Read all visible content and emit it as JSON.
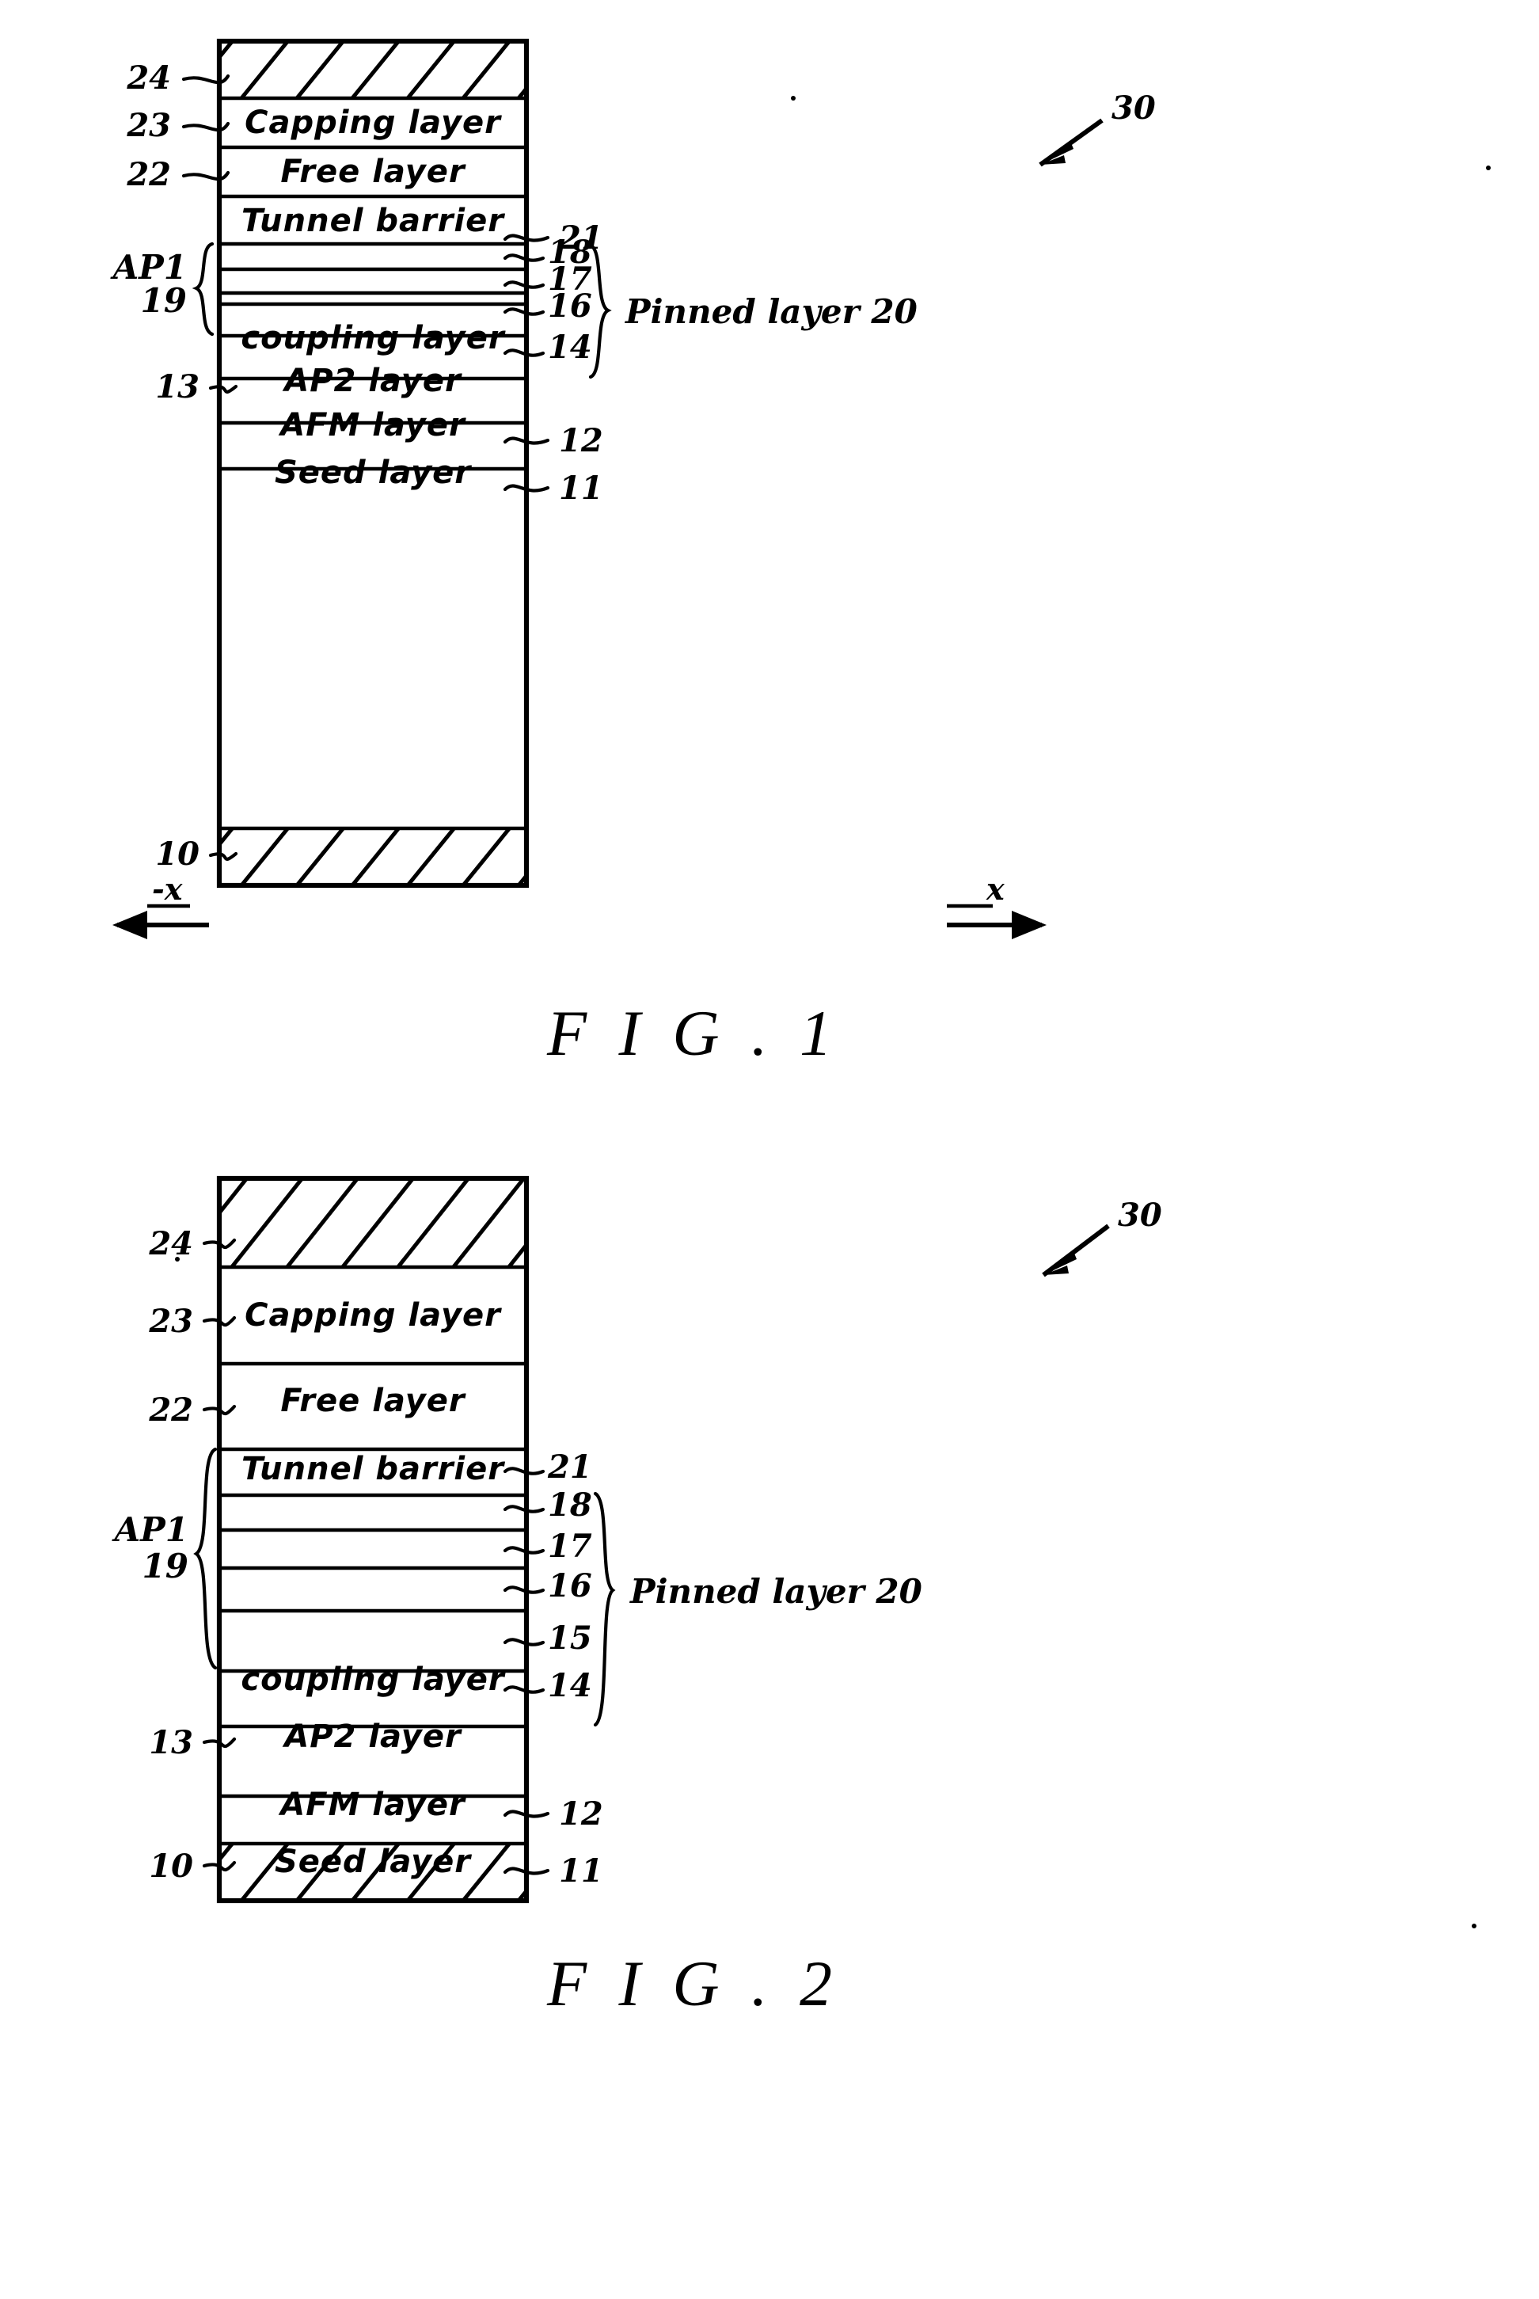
{
  "document": {
    "type": "patent-drawing-sheet",
    "figure_count": 2
  },
  "figures": [
    {
      "id": "fig1",
      "caption": "F I G .   1",
      "assembly_ref": "30",
      "group_left": {
        "label": "AP1",
        "number": "19"
      },
      "group_right": {
        "label": "Pinned layer 20"
      },
      "axis_left": "-x",
      "axis_right": "x",
      "layers": [
        {
          "ref": "24",
          "text": "",
          "side": "left",
          "hatched": true
        },
        {
          "ref": "23",
          "text": "Capping layer",
          "side": "left",
          "hatched": false
        },
        {
          "ref": "22",
          "text": "Free layer",
          "side": "left",
          "hatched": false
        },
        {
          "ref": "21",
          "text": "Tunnel barrier",
          "side": "right",
          "hatched": false
        },
        {
          "ref": "18",
          "text": "",
          "side": "right",
          "hatched": false
        },
        {
          "ref": "17",
          "text": "",
          "side": "right",
          "hatched": false
        },
        {
          "ref": "16",
          "text": "",
          "side": "right",
          "hatched": false
        },
        {
          "ref": "14",
          "text": "coupling layer",
          "side": "right",
          "hatched": false
        },
        {
          "ref": "13",
          "text": "AP2 layer",
          "side": "left",
          "hatched": false
        },
        {
          "ref": "12",
          "text": "AFM layer",
          "side": "right",
          "hatched": false
        },
        {
          "ref": "11",
          "text": "Seed layer",
          "side": "right",
          "hatched": false
        },
        {
          "ref": "10",
          "text": "",
          "side": "left",
          "hatched": true
        }
      ]
    },
    {
      "id": "fig2",
      "caption": "F I G .   2",
      "assembly_ref": "30",
      "group_left": {
        "label": "AP1",
        "number": "19"
      },
      "group_right": {
        "label": "Pinned layer 20"
      },
      "axis_left": "",
      "axis_right": "",
      "layers": [
        {
          "ref": "24",
          "text": "",
          "side": "left",
          "hatched": true
        },
        {
          "ref": "23",
          "text": "Capping layer",
          "side": "left",
          "hatched": false
        },
        {
          "ref": "22",
          "text": "Free layer",
          "side": "left",
          "hatched": false
        },
        {
          "ref": "21",
          "text": "Tunnel barrier",
          "side": "right",
          "hatched": false
        },
        {
          "ref": "18",
          "text": "",
          "side": "right",
          "hatched": false
        },
        {
          "ref": "17",
          "text": "",
          "side": "right",
          "hatched": false
        },
        {
          "ref": "16",
          "text": "",
          "side": "right",
          "hatched": false
        },
        {
          "ref": "15",
          "text": "",
          "side": "right",
          "hatched": false
        },
        {
          "ref": "14",
          "text": "coupling layer",
          "side": "right",
          "hatched": false
        },
        {
          "ref": "13",
          "text": "AP2 layer",
          "side": "left",
          "hatched": false
        },
        {
          "ref": "12",
          "text": "AFM layer",
          "side": "right",
          "hatched": false
        },
        {
          "ref": "11",
          "text": "Seed layer",
          "side": "right",
          "hatched": false
        },
        {
          "ref": "10",
          "text": "",
          "side": "left",
          "hatched": true
        }
      ]
    }
  ],
  "colors": {
    "ink": "#000000",
    "paper": "#ffffff"
  }
}
